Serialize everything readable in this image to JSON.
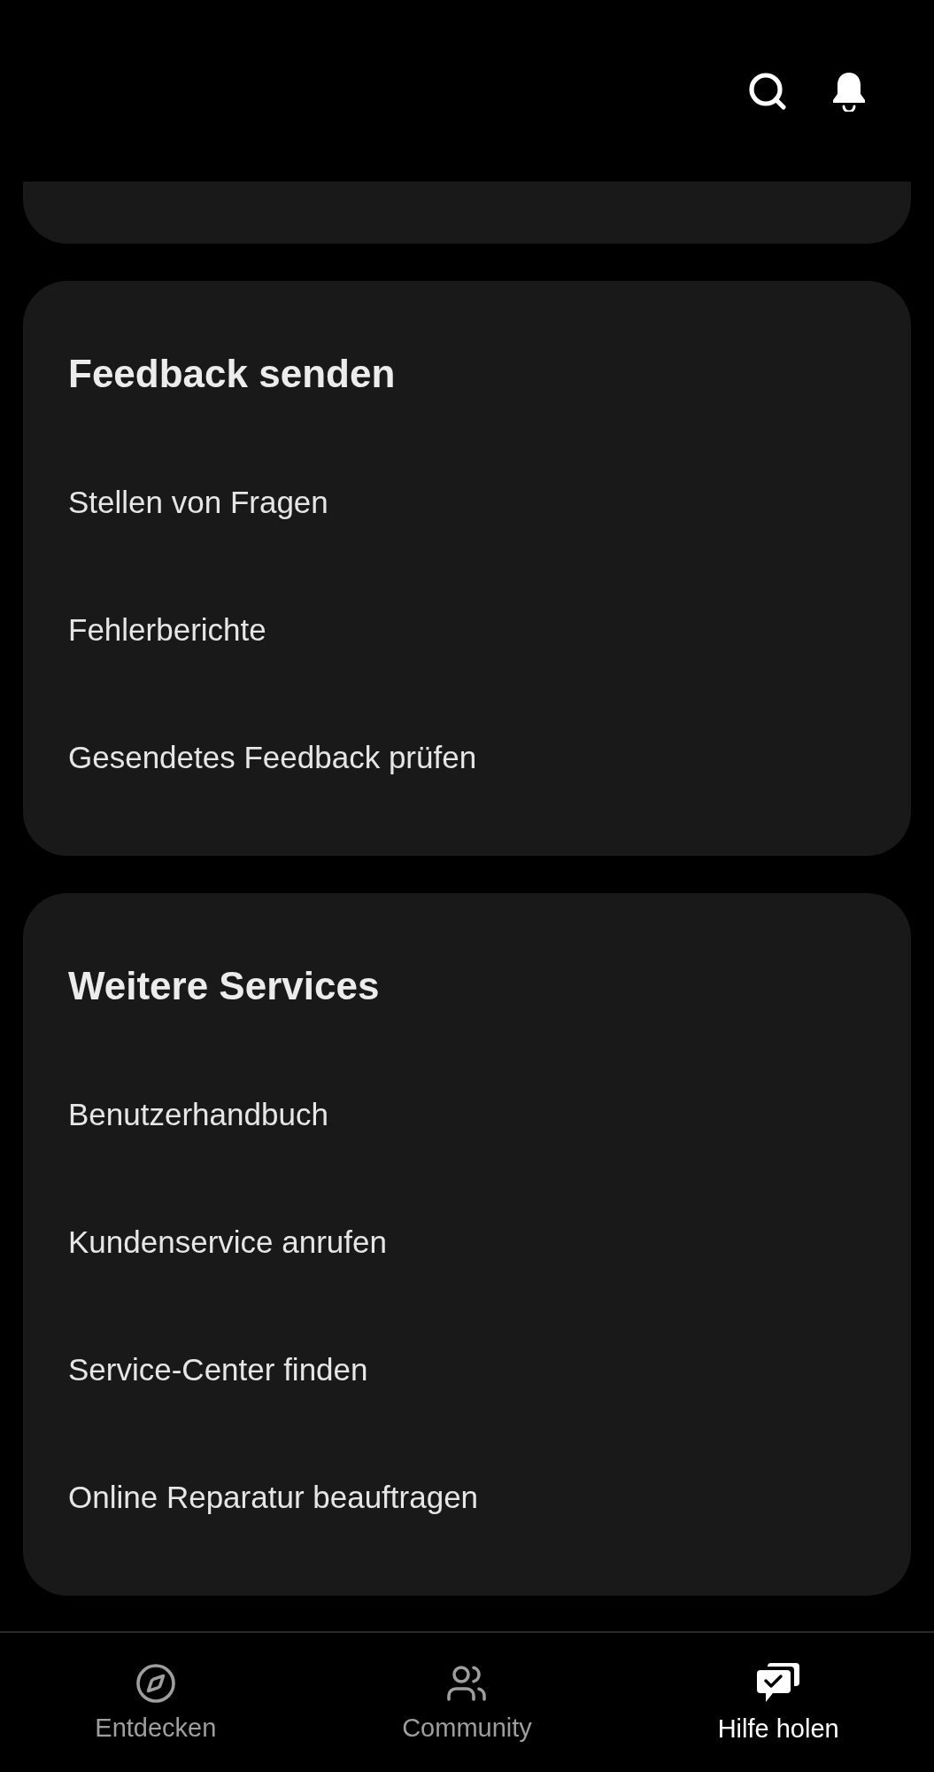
{
  "sections": [
    {
      "title": "Feedback senden",
      "items": [
        "Stellen von Fragen",
        "Fehlerberichte",
        "Gesendetes Feedback prüfen"
      ]
    },
    {
      "title": "Weitere Services",
      "items": [
        "Benutzerhandbuch",
        "Kundenservice anrufen",
        "Service-Center finden",
        "Online Reparatur beauftragen"
      ]
    }
  ],
  "nav_tabs": [
    {
      "kind": "compass",
      "label": "Entdecken",
      "selected": false
    },
    {
      "kind": "people",
      "label": "Community",
      "selected": false
    },
    {
      "kind": "chat",
      "label": "Hilfe holen",
      "selected": true
    }
  ]
}
